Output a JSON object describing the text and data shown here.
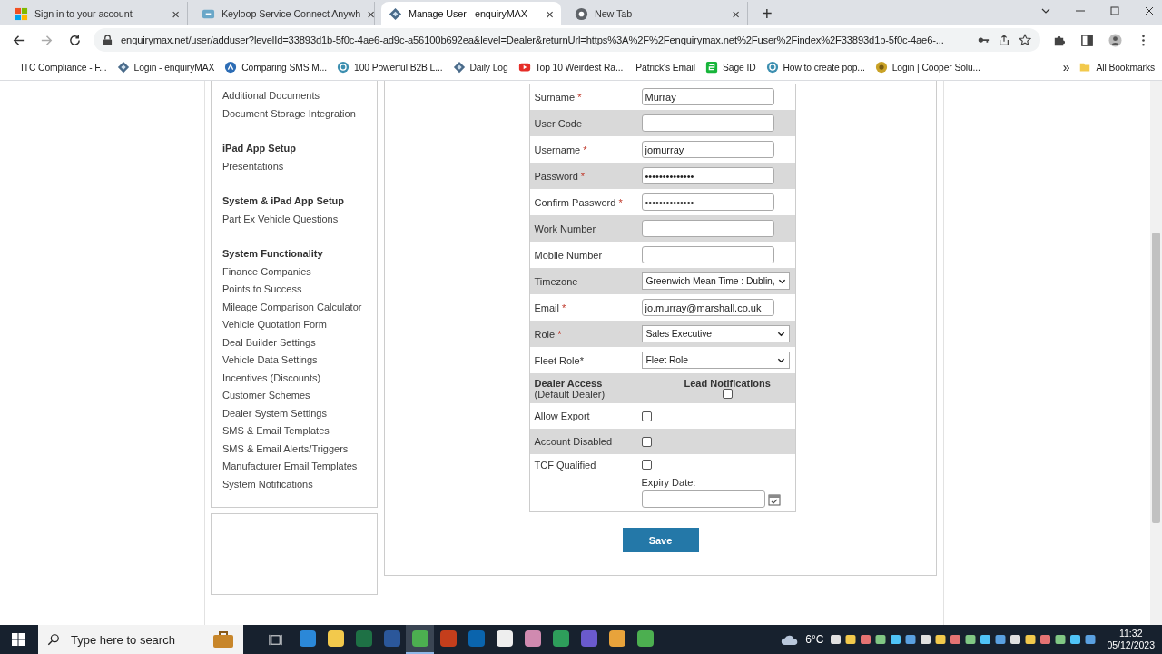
{
  "browser": {
    "tabs": [
      {
        "title": "Sign in to your account",
        "kind": "windows",
        "selected": false
      },
      {
        "title": "Keyloop Service Connect Anywh",
        "kind": "link",
        "selected": false
      },
      {
        "title": "Manage User - enquiryMAX",
        "kind": "diamond",
        "selected": true
      },
      {
        "title": "New Tab",
        "kind": "chrome",
        "selected": false
      }
    ],
    "tab_close": "×",
    "new_tab": "+",
    "url": "enquirymax.net/user/adduser?levelId=33893d1b-5f0c-4ae6-ad9c-a56100b692ea&level=Dealer&returnUrl=https%3A%2F%2Fenquirymax.net%2Fuser%2Findex%2F33893d1b-5f0c-4ae6-...",
    "bookmarks": [
      {
        "label": "ITC Compliance - F...",
        "kind": "none"
      },
      {
        "label": "Login - enquiryMAX",
        "kind": "diamond"
      },
      {
        "label": "Comparing SMS M...",
        "kind": "circle"
      },
      {
        "label": "100 Powerful B2B L...",
        "kind": "swirl"
      },
      {
        "label": "Daily Log",
        "kind": "diamond"
      },
      {
        "label": "Top 10 Weirdest Ra...",
        "kind": "video"
      },
      {
        "label": "Patrick's Email",
        "kind": "none"
      },
      {
        "label": "Sage ID",
        "kind": "square"
      },
      {
        "label": "How to create pop...",
        "kind": "swirl"
      },
      {
        "label": "Login | Cooper Solu...",
        "kind": "gold"
      }
    ],
    "more_bookmarks": "»",
    "all_bookmarks": "All Bookmarks"
  },
  "sidebar": {
    "groups": [
      {
        "items": [
          "Additional Documents",
          "Document Storage Integration"
        ]
      },
      {
        "heading": "iPad App Setup",
        "items": [
          "Presentations"
        ]
      },
      {
        "heading": "System & iPad App Setup",
        "items": [
          "Part Ex Vehicle Questions"
        ]
      },
      {
        "heading": "System Functionality",
        "items": [
          "Finance Companies",
          "Points to Success",
          "Mileage Comparison Calculator",
          "Vehicle Quotation Form",
          "Deal Builder Settings",
          "Vehicle Data Settings",
          "Incentives (Discounts)",
          "Customer Schemes",
          "Dealer System Settings",
          "SMS & Email Templates",
          "SMS & Email Alerts/Triggers",
          "Manufacturer Email Templates",
          "System Notifications"
        ]
      }
    ]
  },
  "form": {
    "rows": [
      {
        "label": "Surname",
        "required": true,
        "kind": "text",
        "value": "Murray"
      },
      {
        "label": "User Code",
        "required": false,
        "kind": "text"
      },
      {
        "label": "Username",
        "required": true,
        "kind": "text",
        "value": "jomurray"
      },
      {
        "label": "Password",
        "required": true,
        "kind": "text",
        "value": "••••••••••••••"
      },
      {
        "label": "Confirm Password",
        "required": true,
        "kind": "text",
        "value": "••••••••••••••"
      },
      {
        "label": "Work Number",
        "required": false,
        "kind": "text"
      },
      {
        "label": "Mobile Number",
        "required": false,
        "kind": "text"
      },
      {
        "label": "Timezone",
        "required": false,
        "kind": "select",
        "value": "Greenwich Mean Time : Dublin,"
      },
      {
        "label": "Email",
        "required": true,
        "kind": "text",
        "value": "jo.murray@marshall.co.uk"
      },
      {
        "label": "Role",
        "required": true,
        "kind": "select",
        "value": "Sales Executive"
      },
      {
        "label": "Fleet Role*",
        "required": false,
        "kind": "select",
        "value": "Fleet Role"
      },
      {
        "label": "Dealer Access",
        "sublabel": "(Default Dealer)",
        "required": false,
        "kind": "header",
        "column": "Lead Notifications",
        "checked": false
      },
      {
        "label": "Allow Export",
        "required": false,
        "kind": "checkbox",
        "checked": false
      },
      {
        "label": "Account Disabled",
        "required": false,
        "kind": "checkbox",
        "checked": false
      },
      {
        "label": "TCF Qualified",
        "required": false,
        "kind": "checkbox_date",
        "checked": false,
        "date_label": "Expiry Date:"
      }
    ],
    "required_mark": "*",
    "save": "Save"
  },
  "taskbar": {
    "search_placeholder": "Type here to search",
    "apps": [
      {
        "color": "#2b88d8",
        "active": false
      },
      {
        "color": "#f2c94c",
        "active": false
      },
      {
        "color": "#1e7145",
        "active": false
      },
      {
        "color": "#2b579a",
        "active": false
      },
      {
        "color": "#4caf50",
        "active": true
      },
      {
        "color": "#c43e1c",
        "active": false
      },
      {
        "color": "#0a64ad",
        "active": false
      },
      {
        "color": "#eeeeee",
        "active": false
      },
      {
        "color": "#d08ab0",
        "active": false
      },
      {
        "color": "#2e9e5b",
        "active": false
      },
      {
        "color": "#6a5acd",
        "active": false
      },
      {
        "color": "#e8a33b",
        "active": false
      },
      {
        "color": "#4caf50",
        "active": false
      }
    ],
    "temperature": "6°C",
    "time": "11:32",
    "date": "05/12/2023"
  }
}
